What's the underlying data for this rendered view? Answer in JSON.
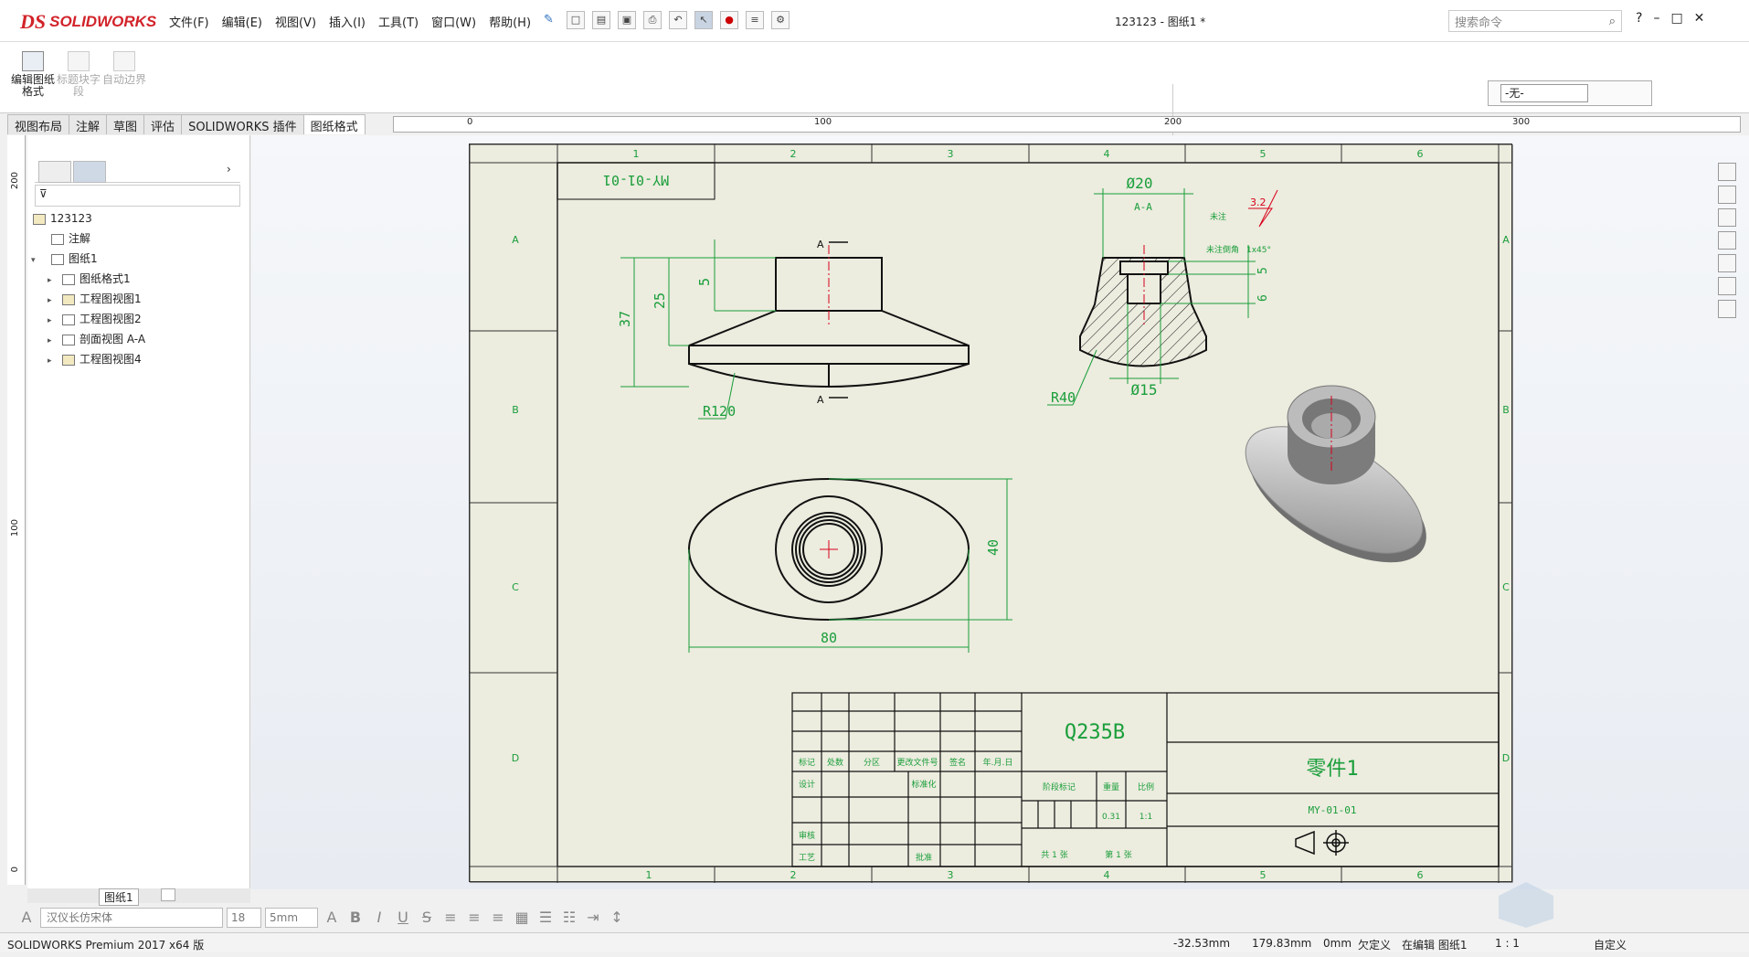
{
  "app": {
    "name": "SOLIDWORKS",
    "doc_title": "123123 - 图纸1 *"
  },
  "menus": [
    "文件(F)",
    "编辑(E)",
    "视图(V)",
    "插入(I)",
    "工具(T)",
    "窗口(W)",
    "帮助(H)"
  ],
  "search": {
    "placeholder": "搜索命令"
  },
  "command_manager": {
    "buttons": [
      {
        "label": "编辑图纸格式",
        "enabled": true
      },
      {
        "label": "标题块字段",
        "enabled": false
      },
      {
        "label": "自动边界",
        "enabled": false
      }
    ],
    "config_value": "-无-"
  },
  "tabs": [
    "视图布局",
    "注解",
    "草图",
    "评估",
    "SOLIDWORKS 插件",
    "图纸格式"
  ],
  "active_tab": "图纸格式",
  "ruler_h": [
    "0",
    "100",
    "200",
    "300"
  ],
  "ruler_v": [
    "200",
    "100",
    "0"
  ],
  "tree": {
    "root": "123123",
    "items": [
      {
        "label": "注解",
        "level": 1
      },
      {
        "label": "图纸1",
        "level": 1,
        "expanded": true
      },
      {
        "label": "图纸格式1",
        "level": 2
      },
      {
        "label": "工程图视图1",
        "level": 2
      },
      {
        "label": "工程图视图2",
        "level": 2
      },
      {
        "label": "剖面视图 A-A",
        "level": 2
      },
      {
        "label": "工程图视图4",
        "level": 2
      }
    ]
  },
  "sheet": {
    "zone_cols": [
      "1",
      "2",
      "3",
      "4",
      "5",
      "6"
    ],
    "zone_rows": [
      "A",
      "B",
      "C",
      "D"
    ],
    "part_no_box": "MY-01-01",
    "dims": {
      "d20": "Ø20",
      "d15": "Ø15",
      "r40": "R40",
      "r120": "R120",
      "h37": "37",
      "h25": "25",
      "h5a": "5",
      "h5b": "5",
      "h6": "6",
      "w80": "80",
      "h40": "40",
      "section": "A-A",
      "roughness": "3.2",
      "label_a": "A"
    },
    "title_block": {
      "material": "Q235B",
      "part_name": "零件1",
      "drawing_no": "MY-01-01",
      "scale_value": "1:1",
      "weight_value": "0.31",
      "labels": [
        "标记",
        "处数",
        "分区",
        "更改文件号",
        "签名",
        "年.月.日",
        "设计",
        "标准化",
        "审核",
        "工艺",
        "批准",
        "阶段标记",
        "重量",
        "比例",
        "共 1 张",
        "第 1 张"
      ],
      "notes": [
        "未注",
        "未注倒角",
        "1x45°"
      ]
    },
    "sheet_tab": "图纸1"
  },
  "font_toolbar": {
    "font": "汉仪长仿宋体",
    "size": "18",
    "height": "5mm"
  },
  "status": {
    "product": "SOLIDWORKS Premium 2017 x64 版",
    "x": "-32.53mm",
    "y": "179.83mm",
    "z": "0mm",
    "defined": "欠定义",
    "editing": "在编辑 图纸1",
    "scale": "1 : 1",
    "units": "自定义"
  },
  "colors": {
    "dim_green": "#1a9e3a",
    "center_red": "#d8001a",
    "sheet_bg": "#ececdf",
    "brand": "#d2232a"
  }
}
